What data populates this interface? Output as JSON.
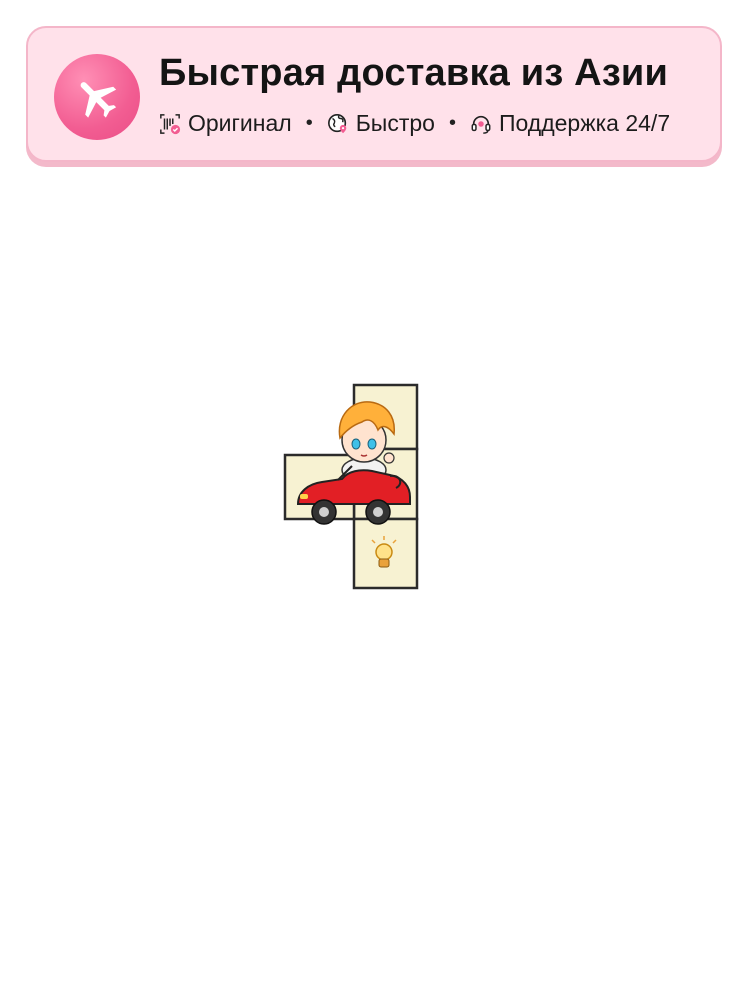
{
  "banner": {
    "title": "Быстрая доставка из Азии",
    "features": [
      {
        "icon": "barcode-check-icon",
        "label": "Оригинал"
      },
      {
        "icon": "globe-icon",
        "label": "Быстро"
      },
      {
        "icon": "headset-icon",
        "label": "Поддержка 24/7"
      }
    ],
    "separator": "•",
    "logo_icon": "airplane-icon"
  },
  "product": {
    "image": "car-character-pin-icon"
  },
  "colors": {
    "banner_bg": "#ffe1ea",
    "banner_border": "#f4b6c9",
    "accent_pink": "#f25d92",
    "car_red": "#e21f25"
  }
}
